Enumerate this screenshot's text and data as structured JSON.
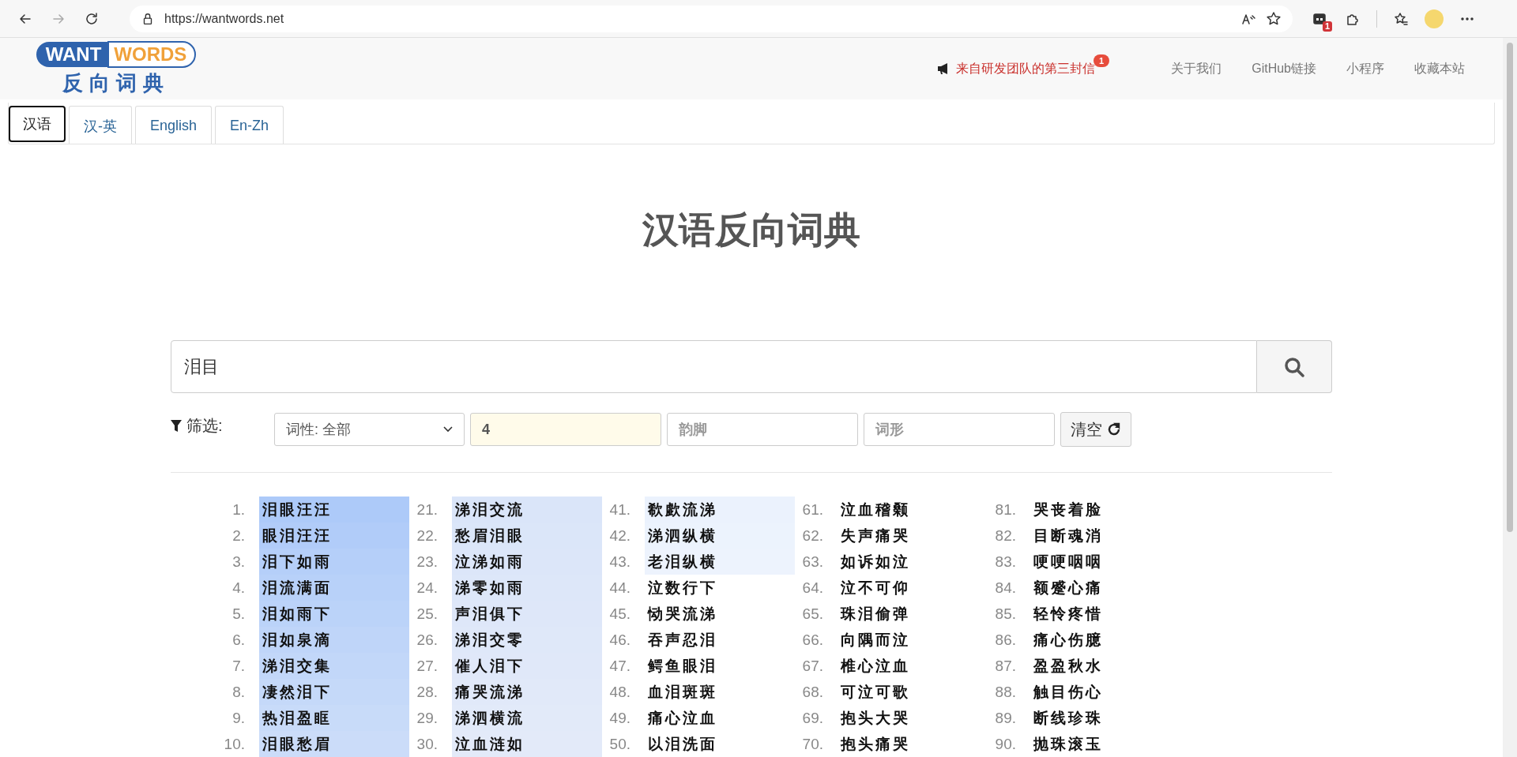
{
  "browser": {
    "url": "https://wantwords.net",
    "extension_badge": "1"
  },
  "header": {
    "logo": {
      "part_1": "WANT",
      "part_2": "WORDS",
      "subtitle": "反向词典"
    },
    "notice": {
      "text": "来自研发团队的第三封信",
      "badge": "1"
    },
    "nav": [
      "关于我们",
      "GitHub链接",
      "小程序",
      "收藏本站"
    ]
  },
  "tabs": [
    {
      "label": "汉语",
      "selected": true
    },
    {
      "label": "汉-英",
      "selected": false
    },
    {
      "label": "English",
      "selected": false
    },
    {
      "label": "En-Zh",
      "selected": false
    }
  ],
  "title": "汉语反向词典",
  "search": {
    "value": "泪目"
  },
  "filter": {
    "label": "筛选:",
    "part_of_speech": "词性: 全部",
    "length_value": "4",
    "rhyme_placeholder": "韵脚",
    "form_placeholder": "词形",
    "clear_button": "清空"
  },
  "results": [
    {
      "items": [
        {
          "number": "1.",
          "word": "泪眼汪汪",
          "color": "#adcaf9"
        },
        {
          "number": "2.",
          "word": "眼泪汪汪",
          "color": "#b1ccf9"
        },
        {
          "number": "3.",
          "word": "泪下如雨",
          "color": "#b5cff9"
        },
        {
          "number": "4.",
          "word": "泪流满面",
          "color": "#b8d1f9"
        },
        {
          "number": "5.",
          "word": "泪如雨下",
          "color": "#bbd3f9"
        },
        {
          "number": "6.",
          "word": "泪如泉滴",
          "color": "#bfd5f9"
        },
        {
          "number": "7.",
          "word": "涕泪交集",
          "color": "#c2d7f9"
        },
        {
          "number": "8.",
          "word": "凄然泪下",
          "color": "#c5d9f9"
        },
        {
          "number": "9.",
          "word": "热泪盈眶",
          "color": "#c8dbf9"
        },
        {
          "number": "10.",
          "word": "泪眼愁眉",
          "color": "#cbdcf9"
        }
      ]
    },
    {
      "items": [
        {
          "number": "21.",
          "word": "涕泪交流",
          "color": "#dae5f9"
        },
        {
          "number": "22.",
          "word": "愁眉泪眼",
          "color": "#dbe6f9"
        },
        {
          "number": "23.",
          "word": "泣涕如雨",
          "color": "#dce6f9"
        },
        {
          "number": "24.",
          "word": "涕零如雨",
          "color": "#dde7f9"
        },
        {
          "number": "25.",
          "word": "声泪俱下",
          "color": "#dee7f9"
        },
        {
          "number": "26.",
          "word": "涕泪交零",
          "color": "#dfe8f9"
        },
        {
          "number": "27.",
          "word": "催人泪下",
          "color": "#e0e8f9"
        },
        {
          "number": "28.",
          "word": "痛哭流涕",
          "color": "#e1e9f9"
        },
        {
          "number": "29.",
          "word": "涕泗横流",
          "color": "#e2eaf9"
        },
        {
          "number": "30.",
          "word": "泣血涟如",
          "color": "#e3eaf9"
        }
      ]
    },
    {
      "items": [
        {
          "number": "41.",
          "word": "欷歔流涕",
          "color": "#ebf2fd"
        },
        {
          "number": "42.",
          "word": "涕泗纵横",
          "color": "#ecf3fd"
        },
        {
          "number": "43.",
          "word": "老泪纵横",
          "color": "#edf3fd"
        },
        {
          "number": "44.",
          "word": "泣数行下"
        },
        {
          "number": "45.",
          "word": "恸哭流涕"
        },
        {
          "number": "46.",
          "word": "吞声忍泪"
        },
        {
          "number": "47.",
          "word": "鳄鱼眼泪"
        },
        {
          "number": "48.",
          "word": "血泪斑斑"
        },
        {
          "number": "49.",
          "word": "痛心泣血"
        },
        {
          "number": "50.",
          "word": "以泪洗面"
        }
      ]
    },
    {
      "items": [
        {
          "number": "61.",
          "word": "泣血稽颡"
        },
        {
          "number": "62.",
          "word": "失声痛哭"
        },
        {
          "number": "63.",
          "word": "如诉如泣"
        },
        {
          "number": "64.",
          "word": "泣不可仰"
        },
        {
          "number": "65.",
          "word": "珠泪偷弹"
        },
        {
          "number": "66.",
          "word": "向隅而泣"
        },
        {
          "number": "67.",
          "word": "椎心泣血"
        },
        {
          "number": "68.",
          "word": "可泣可歌"
        },
        {
          "number": "69.",
          "word": "抱头大哭"
        },
        {
          "number": "70.",
          "word": "抱头痛哭"
        }
      ]
    },
    {
      "items": [
        {
          "number": "81.",
          "word": "哭丧着脸"
        },
        {
          "number": "82.",
          "word": "目断魂消"
        },
        {
          "number": "83.",
          "word": "哽哽咽咽"
        },
        {
          "number": "84.",
          "word": "额蹙心痛"
        },
        {
          "number": "85.",
          "word": "轻怜疼惜"
        },
        {
          "number": "86.",
          "word": "痛心伤臆"
        },
        {
          "number": "87.",
          "word": "盈盈秋水"
        },
        {
          "number": "88.",
          "word": "触目伤心"
        },
        {
          "number": "89.",
          "word": "断线珍珠"
        },
        {
          "number": "90.",
          "word": "抛珠滚玉"
        }
      ]
    }
  ]
}
